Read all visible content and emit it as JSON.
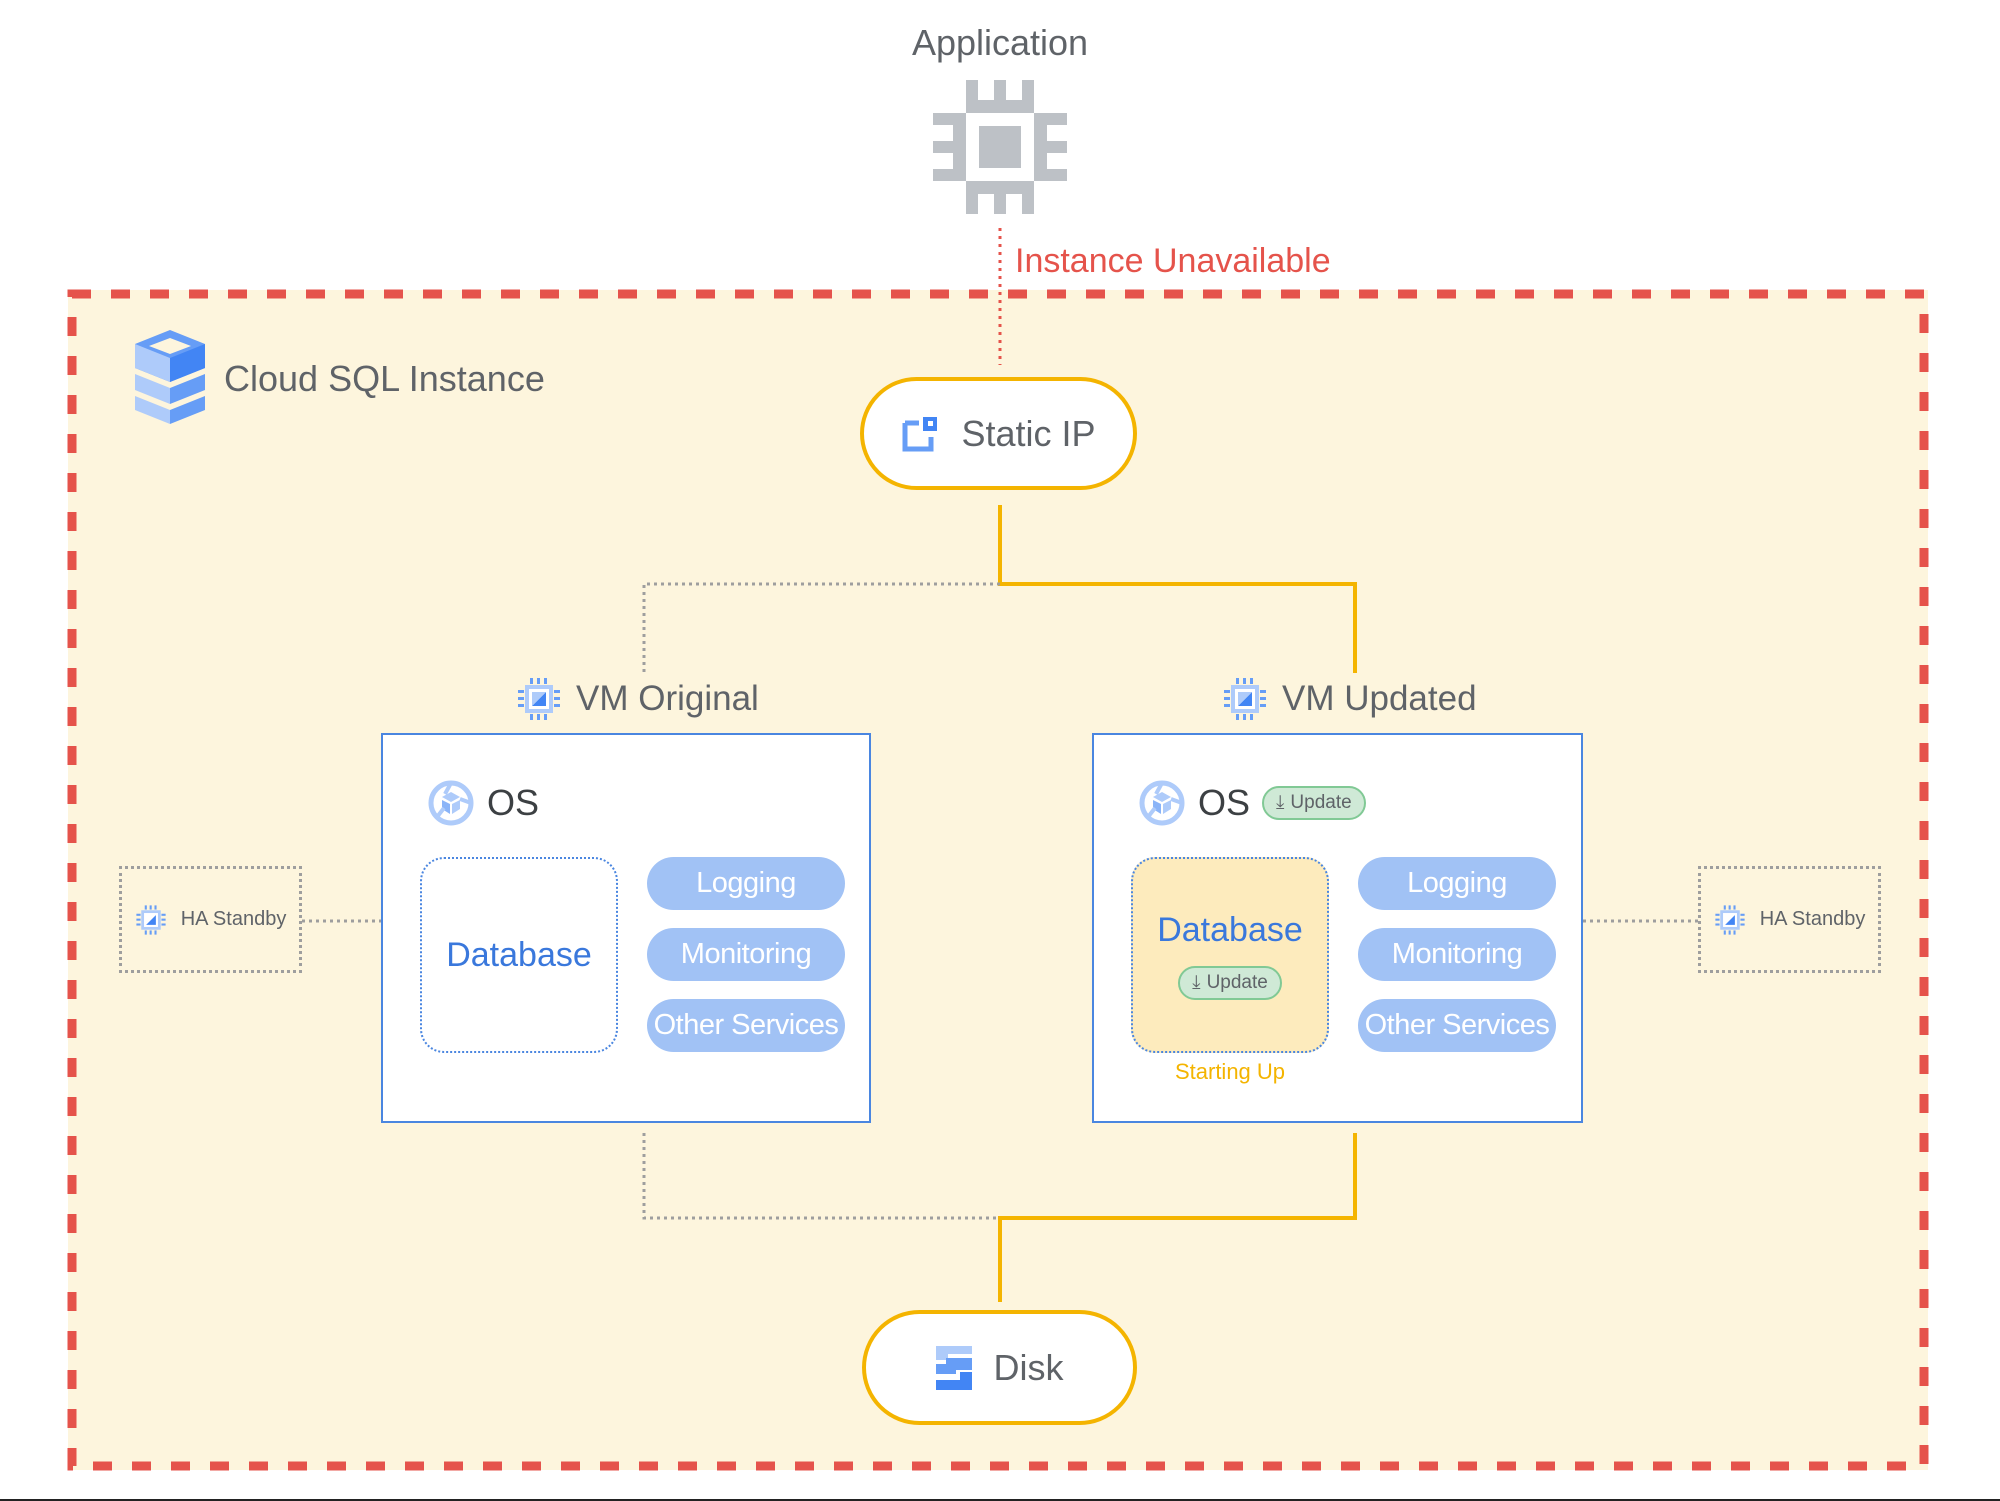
{
  "application": {
    "title": "Application",
    "icon": "cpu-chip-icon"
  },
  "status": {
    "label": "Instance Unavailable",
    "color": "#e5534b"
  },
  "instance": {
    "title": "Cloud SQL Instance",
    "icon": "cloud-sql-icon",
    "background": "#fdf5dd",
    "border_color": "#e5534b"
  },
  "static_ip": {
    "label": "Static IP",
    "icon": "static-ip-icon"
  },
  "vm_original": {
    "label": "VM Original",
    "os_label": "OS",
    "database_label": "Database",
    "services": [
      "Logging",
      "Monitoring",
      "Other Services"
    ]
  },
  "vm_updated": {
    "label": "VM Updated",
    "os_label": "OS",
    "os_badge": "Update",
    "database_label": "Database",
    "database_badge": "Update",
    "database_status": "Starting Up",
    "services": [
      "Logging",
      "Monitoring",
      "Other Services"
    ]
  },
  "ha_standby_left": {
    "label": "HA Standby"
  },
  "ha_standby_right": {
    "label": "HA Standby"
  },
  "disk": {
    "label": "Disk",
    "icon": "persistent-disk-icon"
  },
  "colors": {
    "active_link": "#f4b400",
    "inactive_link": "#9e9e9e",
    "vm_border": "#4a86e0",
    "service_pill": "#a1c2f5",
    "update_badge": "#cfe9d6"
  }
}
